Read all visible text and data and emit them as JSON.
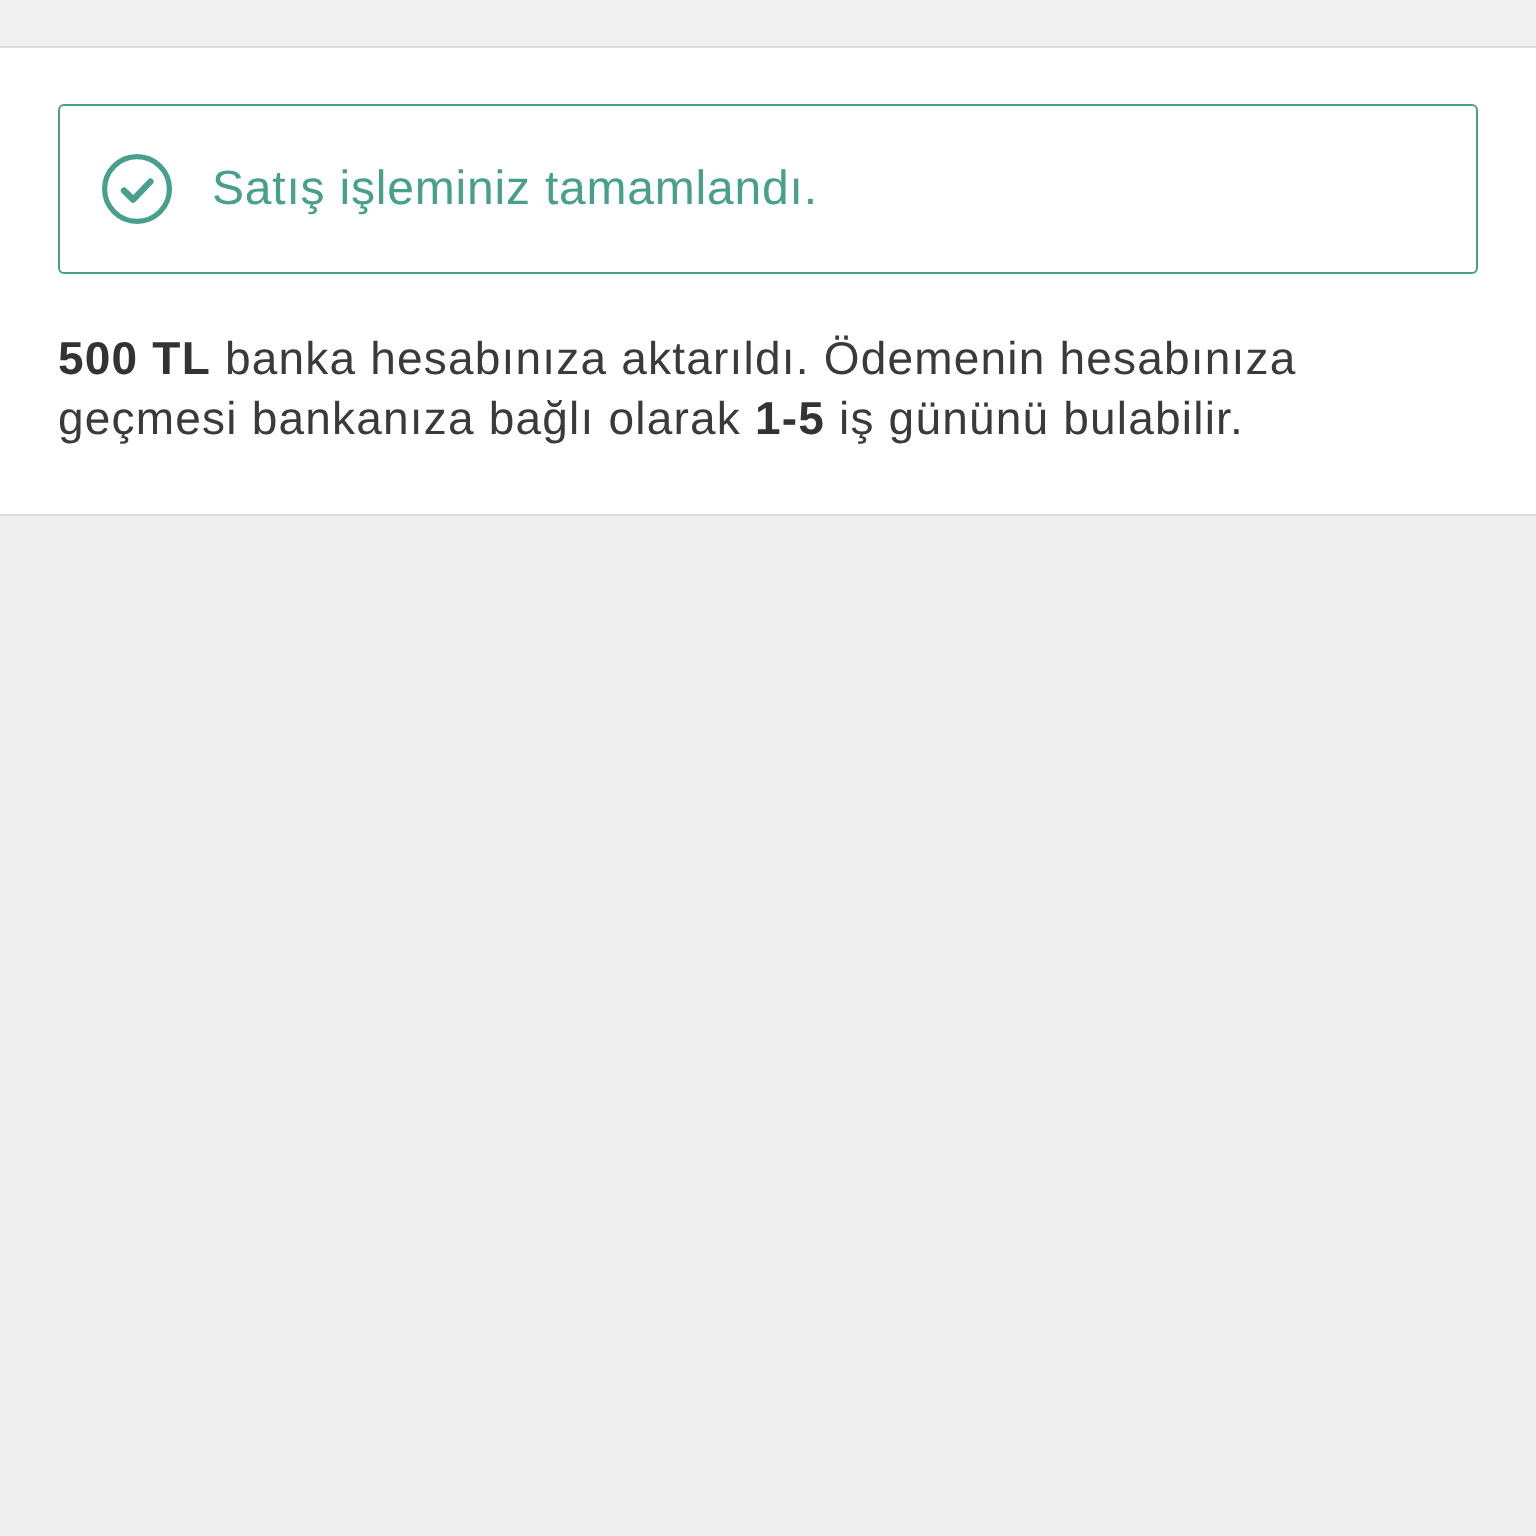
{
  "alert": {
    "kind": "success",
    "message": "Satış işleminiz tamamlandı."
  },
  "info": {
    "text": "**500 TL** banka hesabınıza aktarıldı. Ödemenin hesabınıza geçmesi bankanıza bağlı olarak **1-5** iş gününü bulabilir."
  }
}
